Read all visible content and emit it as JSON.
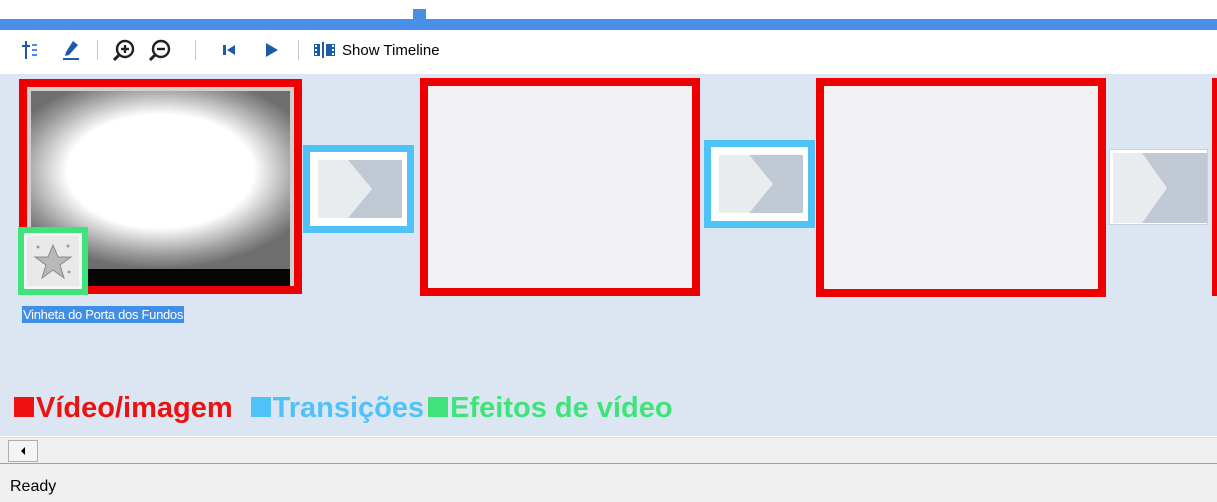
{
  "toolbar": {
    "show_timeline_label": "Show Timeline",
    "icons": [
      "add-narration-icon",
      "set-audio-levels-icon",
      "zoom-in-icon",
      "zoom-out-icon",
      "rewind-icon",
      "play-icon",
      "show-timeline-icon"
    ]
  },
  "storyboard": {
    "clips": [
      {
        "label": "Vinheta do Porta dos Fundos",
        "has_thumbnail": true,
        "has_effect": true
      },
      {
        "label": "",
        "has_thumbnail": false
      },
      {
        "label": "",
        "has_thumbnail": false
      }
    ]
  },
  "legend": {
    "items": [
      {
        "text": "Vídeo/imagem",
        "color": "#ee1111"
      },
      {
        "text": "Transições",
        "color": "#4fc3f7"
      },
      {
        "text": "Efeitos de vídeo",
        "color": "#3ee37a"
      }
    ]
  },
  "colors": {
    "clip_border": "#ee0000",
    "transition_border": "#4fc3f7",
    "effect_border": "#3ee37a",
    "storyboard_bg": "#dce6f2",
    "top_bar": "#4a8fe7"
  },
  "status": {
    "text": "Ready"
  }
}
